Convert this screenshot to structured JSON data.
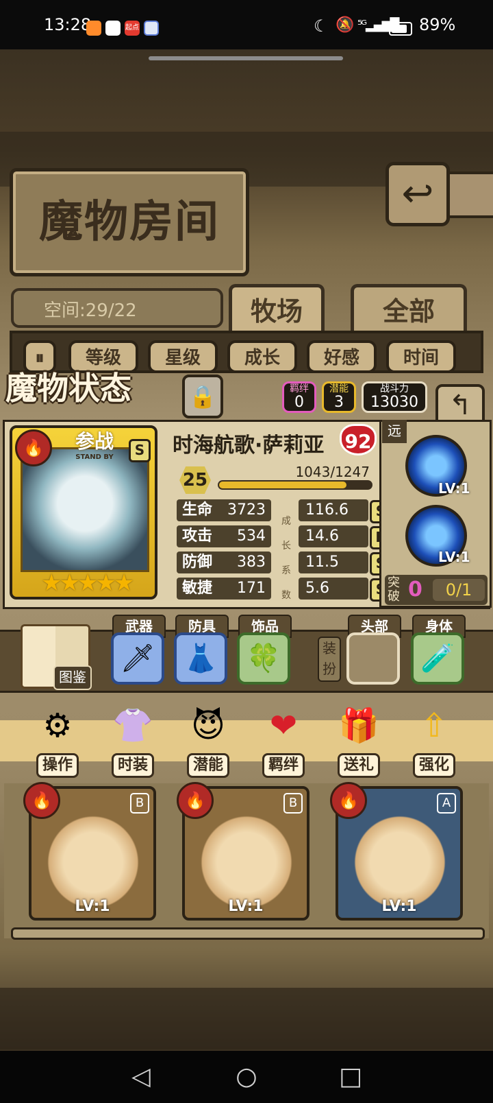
{
  "status_bar": {
    "time": "13:28",
    "app_icons": [
      "bilibili-icon",
      "browser-icon",
      "qidian-icon",
      "iflytek-icon"
    ],
    "qidian_label": "起点",
    "right_icons": [
      "moon-icon",
      "mute-icon",
      "5g-signal-icon",
      "battery-icon"
    ],
    "battery": "89%"
  },
  "room": {
    "title": "魔物房间",
    "space_label": "空间:29/22",
    "tabs": [
      "牧场",
      "全部"
    ],
    "active_tab": "牧场",
    "sort_buttons": [
      "等级",
      "星级",
      "成长",
      "好感",
      "时间"
    ]
  },
  "status_panel": {
    "title": "魔物状态",
    "bond_label": "羁绊",
    "bond_value": "0",
    "potential_label": "潜能",
    "potential_value": "3",
    "power_label": "战斗力",
    "power_value": "13030"
  },
  "monster": {
    "standby": "参战",
    "standby_en": "STAND BY",
    "card_grade": "S",
    "stars": "★★★★★",
    "star_count": 5,
    "name": "时海航歌·萨莉亚",
    "affection": "92",
    "level": "25",
    "exp": "1043/1247",
    "exp_fraction": 0.836,
    "stats": [
      {
        "label": "生命",
        "value": "3723",
        "growth": "116.6",
        "grade": "S"
      },
      {
        "label": "攻击",
        "value": "534",
        "growth": "14.6",
        "grade": "B"
      },
      {
        "label": "防御",
        "value": "383",
        "growth": "11.5",
        "grade": "S"
      },
      {
        "label": "敏捷",
        "value": "171",
        "growth": "5.6",
        "grade": "S"
      }
    ],
    "growth_label": "成长系数",
    "range": "远",
    "skills": [
      {
        "icon": "shadow-fighter-skill-icon",
        "level": "LV:1"
      },
      {
        "icon": "blue-cannon-skill-icon",
        "level": "LV:1"
      }
    ],
    "breakthrough_label": "突破",
    "breakthrough_value": "0",
    "breakthrough_progress": "0/1"
  },
  "equipment": {
    "codex_label": "图鉴",
    "slots": [
      {
        "label": "武器",
        "icon": "sword-icon",
        "color": "#5b86d6"
      },
      {
        "label": "防具",
        "icon": "dress-icon",
        "color": "#5b86d6"
      },
      {
        "label": "饰品",
        "icon": "clover-icon",
        "color": "#6a9a4a"
      },
      {
        "label": "头部",
        "icon": "",
        "color": "#9c8a68"
      },
      {
        "label": "身体",
        "icon": "potion-necklace-icon",
        "color": "#6a9a4a"
      }
    ],
    "dress_up_label": "装扮"
  },
  "menu": [
    {
      "label": "操作",
      "icon": "gear-icon"
    },
    {
      "label": "时装",
      "icon": "outfit-icon"
    },
    {
      "label": "潜能",
      "icon": "demon-icon"
    },
    {
      "label": "羁绊",
      "icon": "hearts-icon"
    },
    {
      "label": "送礼",
      "icon": "gift-icon"
    },
    {
      "label": "强化",
      "icon": "up-arrows-icon"
    }
  ],
  "monster_list": [
    {
      "grade": "B",
      "level": "LV:1",
      "border": "#8a6a2a"
    },
    {
      "grade": "B",
      "level": "LV:1",
      "border": "#8a6a2a"
    },
    {
      "grade": "A",
      "level": "LV:1",
      "border": "#5a86b0"
    }
  ],
  "nav": {
    "back": "◁",
    "home": "○",
    "recent": "□"
  }
}
